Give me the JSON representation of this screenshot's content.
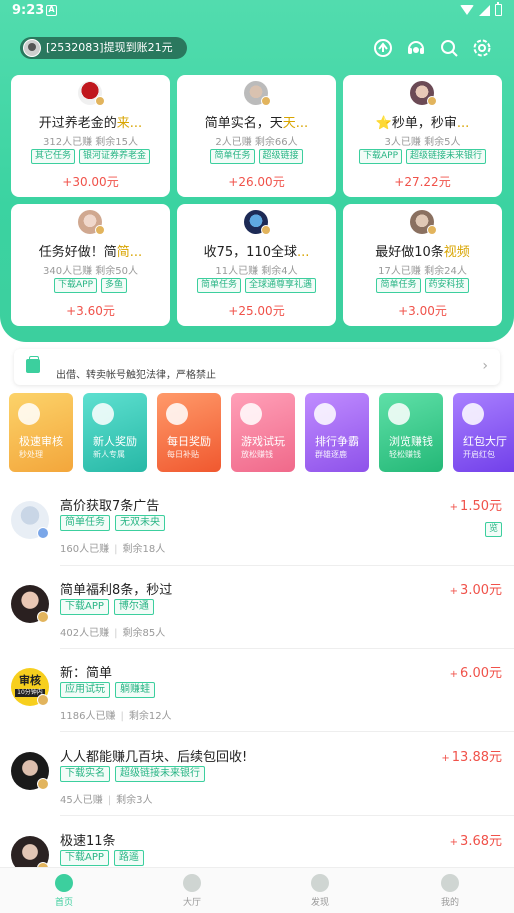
{
  "status_bar": {
    "time": "9:23",
    "notification_icon": "A"
  },
  "header": {
    "ticker_text": "[2532083]提现到账21元",
    "icons": [
      "share-icon",
      "customer-service-icon",
      "search-icon",
      "settings-icon"
    ]
  },
  "featured_tasks": [
    {
      "title": "开过养老金的",
      "title_fade": "来...",
      "joined": "312人已赚",
      "remaining": "剩余15人",
      "tags": [
        "其它任务",
        "银河证券养老金"
      ],
      "price": "+30.00元"
    },
    {
      "title": "简单实名，天",
      "title_fade": "天...",
      "joined": "2人已赚",
      "remaining": "剩余66人",
      "tags": [
        "简单任务",
        "超级链接"
      ],
      "price": "+26.00元"
    },
    {
      "title": "⭐秒单，秒审",
      "title_fade": "...",
      "joined": "3人已赚",
      "remaining": "剩余5人",
      "tags": [
        "下载APP",
        "超级链接未来银行"
      ],
      "price": "+27.22元"
    },
    {
      "title": "任务好做！简",
      "title_fade": "简...",
      "joined": "340人已赚",
      "remaining": "剩余50人",
      "tags": [
        "下载APP",
        "多鱼"
      ],
      "price": "+3.60元"
    },
    {
      "title": "收75，110全球",
      "title_fade": "...",
      "joined": "11人已赚",
      "remaining": "剩余4人",
      "tags": [
        "简单任务",
        "全球通尊享礼遇"
      ],
      "price": "+25.00元"
    },
    {
      "title": "最好做10条",
      "title_fade": "视频",
      "joined": "17人已赚",
      "remaining": "剩余24人",
      "tags": [
        "简单任务",
        "药安科技"
      ],
      "price": "+3.00元"
    }
  ],
  "notice": {
    "text": "出借、转卖帐号触犯法律，严格禁止"
  },
  "categories": [
    {
      "label": "极速审核",
      "sub": "秒处理",
      "color": "#f6b84a"
    },
    {
      "label": "新人奖励",
      "sub": "新人专属",
      "color": "#3cc9b8"
    },
    {
      "label": "每日奖励",
      "sub": "每日补贴",
      "color": "#f7734a"
    },
    {
      "label": "游戏试玩",
      "sub": "放松赚钱",
      "color": "#f77e9c"
    },
    {
      "label": "排行争霸",
      "sub": "群雄逐鹿",
      "color": "#a46bf0"
    },
    {
      "label": "浏览赚钱",
      "sub": "轻松赚钱",
      "color": "#38c98f"
    },
    {
      "label": "红包大厅",
      "sub": "开启红包",
      "color": "#8a55f2"
    }
  ],
  "task_list": [
    {
      "title": "高价获取7条广告",
      "tags": [
        "简单任务",
        "无双未央"
      ],
      "joined": "160人已赚",
      "remaining": "剩余18人",
      "price": "1.50元",
      "extra_tag": "览"
    },
    {
      "title": "简单福利8条，秒过",
      "tags": [
        "下载APP",
        "博尔通"
      ],
      "joined": "402人已赚",
      "remaining": "剩余85人",
      "price": "3.00元",
      "extra_tag": ""
    },
    {
      "title": "新：简单",
      "tags": [
        "应用试玩",
        "躺赚蛙"
      ],
      "joined": "1186人已赚",
      "remaining": "剩余12人",
      "price": "6.00元",
      "extra_tag": "",
      "avatar_text": "审核",
      "avatar_sub": "10分钟内"
    },
    {
      "title": "人人都能赚几百块、后续包回收!",
      "tags": [
        "下载实名",
        "超级链接未来银行"
      ],
      "joined": "45人已赚",
      "remaining": "剩余3人",
      "price": "13.88元",
      "extra_tag": ""
    },
    {
      "title": "极速11条",
      "tags": [
        "下载APP",
        "路遥"
      ],
      "joined": "",
      "remaining": "",
      "price": "3.68元",
      "extra_tag": ""
    }
  ],
  "bottom_nav": [
    {
      "label": "首页",
      "icon": "home-icon",
      "active": true
    },
    {
      "label": "大厅",
      "icon": "hall-icon",
      "active": false
    },
    {
      "label": "发现",
      "icon": "discover-icon",
      "active": false
    },
    {
      "label": "我的",
      "icon": "profile-icon",
      "active": false
    }
  ],
  "colors": {
    "brand_green": "#3ccf9e",
    "price_red": "#f0524a"
  }
}
